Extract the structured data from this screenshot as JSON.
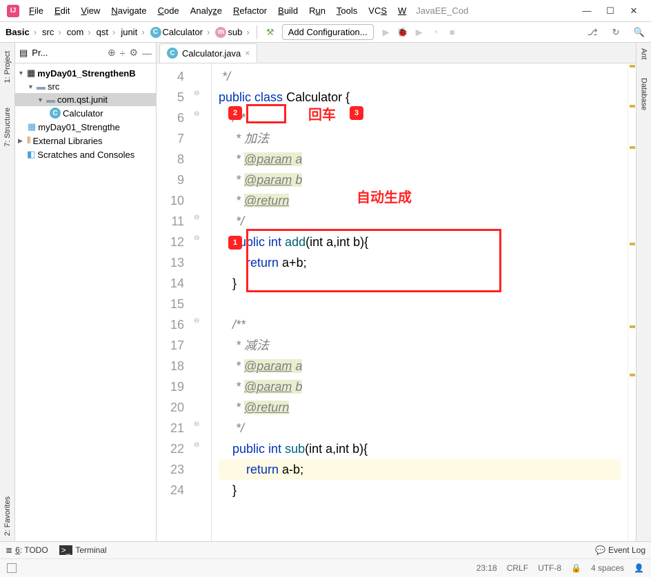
{
  "title": "JavaEE_Cod",
  "menu": [
    "File",
    "Edit",
    "View",
    "Navigate",
    "Code",
    "Analyze",
    "Refactor",
    "Build",
    "Run",
    "Tools",
    "VCS",
    "Window"
  ],
  "breadcrumbs": [
    {
      "label": "Basic",
      "bold": true
    },
    {
      "label": "src"
    },
    {
      "label": "com"
    },
    {
      "label": "qst"
    },
    {
      "label": "junit"
    },
    {
      "label": "Calculator",
      "icon": "c"
    },
    {
      "label": "sub",
      "icon": "m"
    }
  ],
  "config_button": "Add Configuration...",
  "panel": {
    "title": "Pr..."
  },
  "tree": [
    {
      "label": "myDay01_StrengthenB",
      "type": "project",
      "bold": true,
      "indent": 0,
      "arrow": "down"
    },
    {
      "label": "src",
      "type": "folder",
      "indent": 1,
      "arrow": "down"
    },
    {
      "label": "com.qst.junit",
      "type": "package",
      "indent": 2,
      "arrow": "down",
      "selected": true
    },
    {
      "label": "Calculator",
      "type": "class",
      "indent": 3
    },
    {
      "label": "myDay01_Strengthe",
      "type": "iml",
      "indent": 1
    },
    {
      "label": "External Libraries",
      "type": "lib",
      "indent": 0,
      "arrow": "right"
    },
    {
      "label": "Scratches and Consoles",
      "type": "scratch",
      "indent": 0
    }
  ],
  "tab": {
    "name": "Calculator.java"
  },
  "line_numbers": [
    4,
    5,
    6,
    7,
    8,
    9,
    10,
    11,
    12,
    13,
    14,
    15,
    16,
    17,
    18,
    19,
    20,
    21,
    22,
    23,
    24
  ],
  "code": {
    "l4": " */",
    "l5_kw1": "public",
    "l5_kw2": "class",
    "l5_name": "Calculator",
    "l5_brace": " {",
    "l6": "/**",
    "l7": " * 加法",
    "l8_pre": " * ",
    "l8_tag": "@param",
    "l8_post": " a",
    "l9_pre": " * ",
    "l9_tag": "@param",
    "l9_post": " b",
    "l10_pre": " * ",
    "l10_tag": "@return",
    "l11": " */",
    "l12_kw1": "public",
    "l12_kw2": "int",
    "l12_name": "add",
    "l12_sig": "(int a,int b){",
    "l13_kw": "return",
    "l13_expr": " a+b;",
    "l14": "}",
    "l16": "/**",
    "l17": " * 减法",
    "l18_pre": " * ",
    "l18_tag": "@param",
    "l18_post": " a",
    "l19_pre": " * ",
    "l19_tag": "@param",
    "l19_post": " b",
    "l20_pre": " * ",
    "l20_tag": "@return",
    "l21": " */",
    "l22_kw1": "public",
    "l22_kw2": "int",
    "l22_name": "sub",
    "l22_sig": "(int a,int b){",
    "l23_kw": "return",
    "l23_expr": " a-b;",
    "l24": "}"
  },
  "annotations": {
    "badge1": "1",
    "badge2": "2",
    "badge3": "3",
    "enter": "回车",
    "auto": "自动生成"
  },
  "side_tabs": {
    "project": "1: Project",
    "structure": "7: Structure",
    "favorites": "2: Favorites",
    "ant": "Ant",
    "database": "Database"
  },
  "bottom": {
    "todo": "6: TODO",
    "terminal": "Terminal",
    "event_log": "Event Log"
  },
  "status": {
    "pos": "23:18",
    "crlf": "CRLF",
    "enc": "UTF-8",
    "indent": "4 spaces"
  }
}
